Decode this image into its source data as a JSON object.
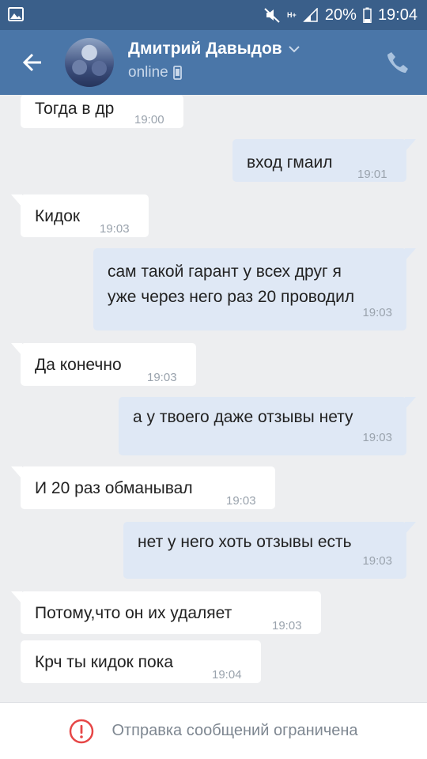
{
  "status_bar": {
    "battery_percent": "20%",
    "time": "19:04",
    "network_label": "H+"
  },
  "header": {
    "contact_name": "Дмитрий Давыдов",
    "contact_status": "online"
  },
  "messages": [
    {
      "direction": "in",
      "text": "Тогда в др",
      "time": "19:00"
    },
    {
      "direction": "out",
      "text": "вход гмаил",
      "time": "19:01"
    },
    {
      "direction": "in",
      "text": "Кидок",
      "time": "19:03"
    },
    {
      "direction": "out",
      "text": "сам такой гарант у всех друг я\nуже через него раз 20 проводил",
      "time": "19:03"
    },
    {
      "direction": "in",
      "text": "Да конечно",
      "time": "19:03"
    },
    {
      "direction": "out",
      "text": "а у твоего даже отзывы нету",
      "time": "19:03"
    },
    {
      "direction": "in",
      "text": "И 20 раз обманывал",
      "time": "19:03"
    },
    {
      "direction": "out",
      "text": "нет у него хоть отзывы есть",
      "time": "19:03"
    },
    {
      "direction": "in",
      "text": "Потому,что он их удаляет",
      "time": "19:03"
    },
    {
      "direction": "in",
      "text": "Крч ты кидок пока",
      "time": "19:04"
    }
  ],
  "footer": {
    "notice": "Отправка сообщений ограничена"
  },
  "colors": {
    "status_bar": "#3a5f8a",
    "header": "#4a76a8",
    "chat_background": "#edeef0",
    "incoming_bubble": "#ffffff",
    "outgoing_bubble": "#dfe8f5",
    "warning": "#e64646"
  },
  "icons": {
    "status_bar": [
      "gallery-icon",
      "mute-icon",
      "signal-icon",
      "battery-icon"
    ],
    "header": [
      "back-arrow-icon",
      "chevron-down-icon",
      "phone-online-icon",
      "phone-call-icon"
    ],
    "footer": [
      "warning-icon"
    ]
  }
}
